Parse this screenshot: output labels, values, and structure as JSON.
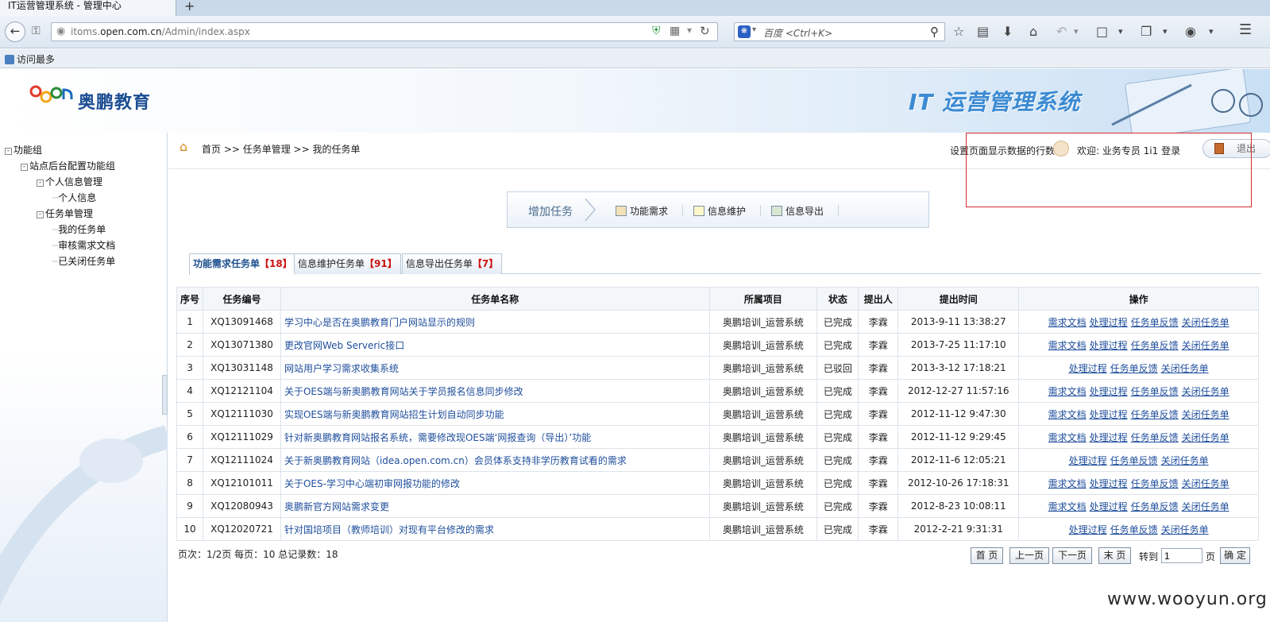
{
  "browser": {
    "tab_title": "IT运营管理系统 - 管理中心",
    "new_tab": "+",
    "url_prefix": "itoms.",
    "url_domain": "open.com.cn",
    "url_path": "/Admin/index.aspx",
    "search_placeholder": "百度 <Ctrl+K>",
    "bookmark": "访问最多"
  },
  "header": {
    "logo_text": "奥鹏教育",
    "system_title": "IT 运营管理系统"
  },
  "sidebar": {
    "tree": [
      {
        "label": "功能组",
        "level": 0,
        "toggle": "-"
      },
      {
        "label": "站点后台配置功能组",
        "level": 1,
        "toggle": "-"
      },
      {
        "label": "个人信息管理",
        "level": 2,
        "toggle": "-"
      },
      {
        "label": "个人信息",
        "level": 3,
        "toggle": ""
      },
      {
        "label": "任务单管理",
        "level": 2,
        "toggle": "-"
      },
      {
        "label": "我的任务单",
        "level": 3,
        "toggle": ""
      },
      {
        "label": "审核需求文档",
        "level": 3,
        "toggle": ""
      },
      {
        "label": "已关闭任务单",
        "level": 3,
        "toggle": ""
      }
    ]
  },
  "topbar": {
    "breadcrumb": "首页 >> 任务单管理 >> 我的任务单",
    "row_setting": "设置页面显示数据的行数",
    "welcome": "欢迎: 业务专员 1i1 登录",
    "logout": "退出"
  },
  "toolbar": {
    "add_task": "增加任务",
    "buttons": [
      "功能需求",
      "信息维护",
      "信息导出"
    ]
  },
  "tabs": [
    {
      "label": "功能需求任务单",
      "count": "【18】"
    },
    {
      "label": "信息维护任务单",
      "count": "【91】"
    },
    {
      "label": "信息导出任务单",
      "count": "【7】"
    }
  ],
  "table": {
    "headers": [
      "序号",
      "任务编号",
      "任务单名称",
      "所属项目",
      "状态",
      "提出人",
      "提出时间",
      "操作"
    ],
    "op_labels": {
      "doc": "需求文档",
      "process": "处理过程",
      "feedback": "任务单反馈",
      "close": "关闭任务单"
    },
    "rows": [
      {
        "no": "1",
        "code": "XQ13091468",
        "name": "学习中心是否在奥鹏教育门户网站显示的规则",
        "project": "奥鹏培训_运营系统",
        "status": "已完成",
        "person": "李霖",
        "time": "2013-9-11 13:38:27",
        "has_doc": true
      },
      {
        "no": "2",
        "code": "XQ13071380",
        "name": "更改官网Web Serveric接口",
        "project": "奥鹏培训_运营系统",
        "status": "已完成",
        "person": "李霖",
        "time": "2013-7-25 11:17:10",
        "has_doc": true
      },
      {
        "no": "3",
        "code": "XQ13031148",
        "name": "网站用户学习需求收集系统",
        "project": "奥鹏培训_运营系统",
        "status": "已驳回",
        "person": "李霖",
        "time": "2013-3-12 17:18:21",
        "has_doc": false
      },
      {
        "no": "4",
        "code": "XQ12121104",
        "name": "关于OES端与新奥鹏教育网站关于学员报名信息同步修改",
        "project": "奥鹏培训_运营系统",
        "status": "已完成",
        "person": "李霖",
        "time": "2012-12-27 11:57:16",
        "has_doc": true
      },
      {
        "no": "5",
        "code": "XQ12111030",
        "name": "实现OES端与新奥鹏教育网站招生计划自动同步功能",
        "project": "奥鹏培训_运营系统",
        "status": "已完成",
        "person": "李霖",
        "time": "2012-11-12 9:47:30",
        "has_doc": true
      },
      {
        "no": "6",
        "code": "XQ12111029",
        "name": "针对新奥鹏教育网站报名系统，需要修改现OES端‘网报查询（导出）’功能",
        "project": "奥鹏培训_运营系统",
        "status": "已完成",
        "person": "李霖",
        "time": "2012-11-12 9:29:45",
        "has_doc": true
      },
      {
        "no": "7",
        "code": "XQ12111024",
        "name": "关于新奥鹏教育网站（idea.open.com.cn）会员体系支持非学历教育试看的需求",
        "project": "奥鹏培训_运营系统",
        "status": "已完成",
        "person": "李霖",
        "time": "2012-11-6 12:05:21",
        "has_doc": false
      },
      {
        "no": "8",
        "code": "XQ12101011",
        "name": "关于OES-学习中心端初审网报功能的修改",
        "project": "奥鹏培训_运营系统",
        "status": "已完成",
        "person": "李霖",
        "time": "2012-10-26 17:18:31",
        "has_doc": true
      },
      {
        "no": "9",
        "code": "XQ12080943",
        "name": "奥鹏新官方网站需求变更",
        "project": "奥鹏培训_运营系统",
        "status": "已完成",
        "person": "李霖",
        "time": "2012-8-23 10:08:11",
        "has_doc": true
      },
      {
        "no": "10",
        "code": "XQ12020721",
        "name": "针对国培项目（教师培训）对现有平台修改的需求",
        "project": "奥鹏培训_运营系统",
        "status": "已完成",
        "person": "李霖",
        "time": "2012-2-21 9:31:31",
        "has_doc": false
      }
    ]
  },
  "pager": {
    "info": "页次：1/2页 每页：10 总记录数：18",
    "first": "首 页",
    "prev": "上一页",
    "next": "下一页",
    "last": "末 页",
    "goto": "转到",
    "page_value": "1",
    "unit": "页",
    "confirm": "确 定"
  },
  "watermark": "www.wooyun.org",
  "colors": {
    "link": "#1f4e9c",
    "count_red": "#cc1111",
    "highlight_box": "#d32f2f",
    "title_blue": "#3b8ad2"
  }
}
